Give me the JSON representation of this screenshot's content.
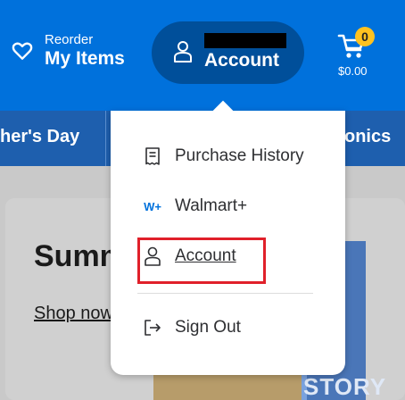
{
  "header": {
    "reorder_small": "Reorder",
    "reorder_big": "My Items",
    "account_label": "Account",
    "cart_count": "0",
    "cart_total": "$0.00",
    "bg_color": "#0071dc",
    "pill_color": "#004f9a",
    "badge_color": "#ffc220"
  },
  "nav": {
    "left_partial": "her's Day",
    "right_partial": "onics"
  },
  "page": {
    "hero_title_partial": "Summ",
    "shop_link_partial": "Shop now",
    "book_text_partial": "STORY"
  },
  "dropdown": {
    "items": [
      {
        "label": "Purchase History",
        "icon": "receipt-icon"
      },
      {
        "label": "Walmart+",
        "icon": "walmart-plus-icon",
        "icon_text": "W+"
      },
      {
        "label": "Account",
        "icon": "person-icon"
      },
      {
        "label": "Sign Out",
        "icon": "sign-out-icon"
      }
    ],
    "highlight_color": "#e0202a"
  }
}
